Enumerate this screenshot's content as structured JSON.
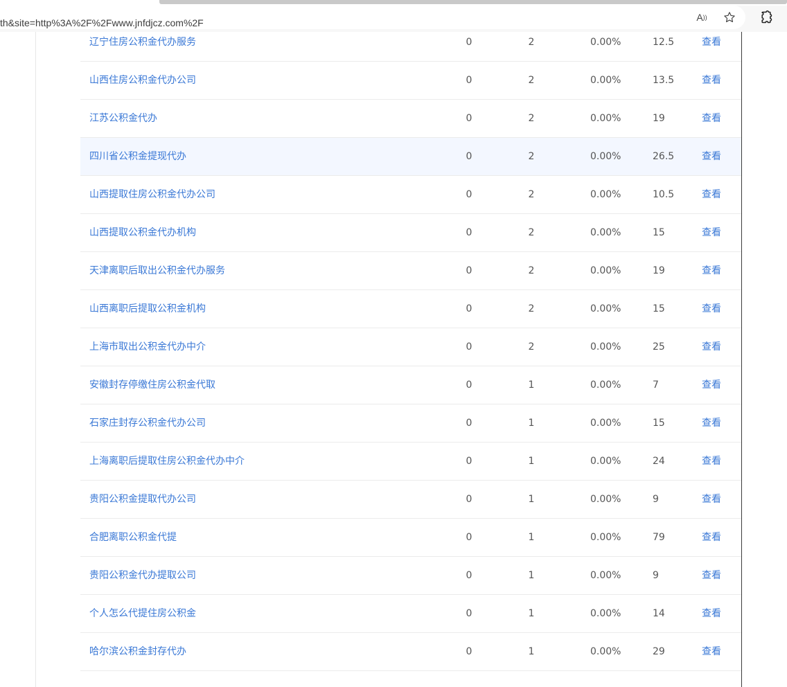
{
  "browser": {
    "address": "th&site=http%3A%2F%2Fwww.jnfdjcz.com%2F",
    "read_aloud_icon": "read-aloud-icon",
    "favorite_icon": "star-icon",
    "extensions_icon": "puzzle-icon"
  },
  "table": {
    "rows": [
      {
        "keyword": "辽宁住房公积金代办服务",
        "a": "0",
        "b": "2",
        "pct": "0.00%",
        "num": "12.5",
        "action": "查看"
      },
      {
        "keyword": "山西住房公积金代办公司",
        "a": "0",
        "b": "2",
        "pct": "0.00%",
        "num": "13.5",
        "action": "查看"
      },
      {
        "keyword": "江苏公积金代办",
        "a": "0",
        "b": "2",
        "pct": "0.00%",
        "num": "19",
        "action": "查看"
      },
      {
        "keyword": "四川省公积金提现代办",
        "a": "0",
        "b": "2",
        "pct": "0.00%",
        "num": "26.5",
        "action": "查看",
        "highlight": true
      },
      {
        "keyword": "山西提取住房公积金代办公司",
        "a": "0",
        "b": "2",
        "pct": "0.00%",
        "num": "10.5",
        "action": "查看"
      },
      {
        "keyword": "山西提取公积金代办机构",
        "a": "0",
        "b": "2",
        "pct": "0.00%",
        "num": "15",
        "action": "查看"
      },
      {
        "keyword": "天津离职后取出公积金代办服务",
        "a": "0",
        "b": "2",
        "pct": "0.00%",
        "num": "19",
        "action": "查看"
      },
      {
        "keyword": "山西离职后提取公积金机构",
        "a": "0",
        "b": "2",
        "pct": "0.00%",
        "num": "15",
        "action": "查看"
      },
      {
        "keyword": "上海市取出公积金代办中介",
        "a": "0",
        "b": "2",
        "pct": "0.00%",
        "num": "25",
        "action": "查看"
      },
      {
        "keyword": "安徽封存停缴住房公积金代取",
        "a": "0",
        "b": "1",
        "pct": "0.00%",
        "num": "7",
        "action": "查看"
      },
      {
        "keyword": "石家庄封存公积金代办公司",
        "a": "0",
        "b": "1",
        "pct": "0.00%",
        "num": "15",
        "action": "查看"
      },
      {
        "keyword": "上海离职后提取住房公积金代办中介",
        "a": "0",
        "b": "1",
        "pct": "0.00%",
        "num": "24",
        "action": "查看"
      },
      {
        "keyword": "贵阳公积金提取代办公司",
        "a": "0",
        "b": "1",
        "pct": "0.00%",
        "num": "9",
        "action": "查看"
      },
      {
        "keyword": "合肥离职公积金代提",
        "a": "0",
        "b": "1",
        "pct": "0.00%",
        "num": "79",
        "action": "查看"
      },
      {
        "keyword": "贵阳公积金代办提取公司",
        "a": "0",
        "b": "1",
        "pct": "0.00%",
        "num": "9",
        "action": "查看"
      },
      {
        "keyword": "个人怎么代提住房公积金",
        "a": "0",
        "b": "1",
        "pct": "0.00%",
        "num": "14",
        "action": "查看"
      },
      {
        "keyword": "哈尔滨公积金封存代办",
        "a": "0",
        "b": "1",
        "pct": "0.00%",
        "num": "29",
        "action": "查看"
      }
    ]
  },
  "colors": {
    "link": "#3a78d6",
    "highlight_row": "#f3f7ff"
  }
}
